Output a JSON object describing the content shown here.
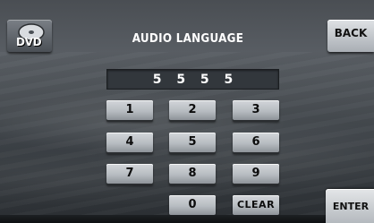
{
  "header": {
    "title": "AUDIO LANGUAGE",
    "source_label": "DVD",
    "back_label": "BACK"
  },
  "entry": {
    "value": "5 5 5 5"
  },
  "keypad": {
    "rows": [
      [
        "1",
        "2",
        "3"
      ],
      [
        "4",
        "5",
        "6"
      ],
      [
        "7",
        "8",
        "9"
      ]
    ],
    "zero": "0",
    "clear": "CLEAR"
  },
  "footer": {
    "enter_label": "ENTER"
  },
  "colors": {
    "background": "#4f5459",
    "key_face": "#c3c7cb",
    "text": "#ffffff"
  },
  "icons": {
    "source": "dvd-disc-icon"
  }
}
